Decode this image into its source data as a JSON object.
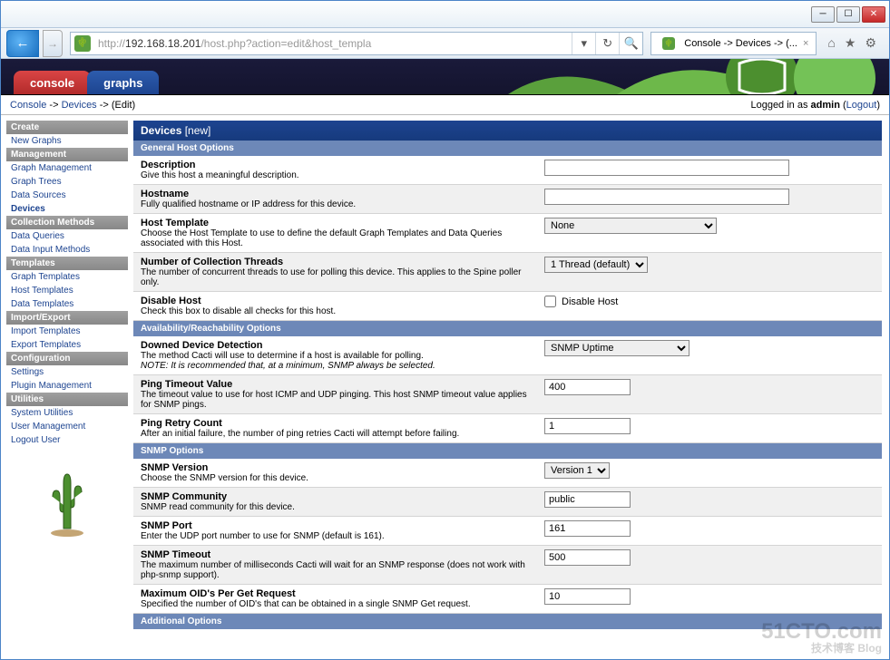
{
  "browser": {
    "url_prefix_grey": "http://",
    "url_host": "192.168.18.201",
    "url_path_grey": "/host.php?action=edit&host_templa",
    "tab_title": "Console -> Devices -> (...",
    "home_icon": "⌂",
    "star_icon": "★",
    "gear_icon": "⚙",
    "back_icon": "←",
    "fwd_icon": "→",
    "refresh_icon": "↻",
    "search_icon": "🔍",
    "dropdown_icon": "▾",
    "close_icon": "×"
  },
  "tabs": {
    "console": "console",
    "graphs": "graphs"
  },
  "breadcrumb": {
    "console": "Console",
    "devices": "Devices",
    "edit": "(Edit)"
  },
  "login": {
    "prefix": "Logged in as ",
    "user": "admin",
    "logout": "Logout"
  },
  "sidebar": {
    "create": "Create",
    "new_graphs": "New Graphs",
    "management": "Management",
    "graph_management": "Graph Management",
    "graph_trees": "Graph Trees",
    "data_sources": "Data Sources",
    "devices": "Devices",
    "collection_methods": "Collection Methods",
    "data_queries": "Data Queries",
    "data_input_methods": "Data Input Methods",
    "templates": "Templates",
    "graph_templates": "Graph Templates",
    "host_templates": "Host Templates",
    "data_templates": "Data Templates",
    "import_export": "Import/Export",
    "import_templates": "Import Templates",
    "export_templates": "Export Templates",
    "configuration": "Configuration",
    "settings": "Settings",
    "plugin_management": "Plugin Management",
    "utilities": "Utilities",
    "system_utilities": "System Utilities",
    "user_management": "User Management",
    "logout_user": "Logout User"
  },
  "panel": {
    "title": "Devices ",
    "new": "[new]"
  },
  "sections": {
    "general": "General Host Options",
    "availability": "Availability/Reachability Options",
    "snmp": "SNMP Options",
    "additional": "Additional Options"
  },
  "fields": {
    "description": {
      "label": "Description",
      "desc": "Give this host a meaningful description.",
      "value": ""
    },
    "hostname": {
      "label": "Hostname",
      "desc": "Fully qualified hostname or IP address for this device.",
      "value": ""
    },
    "host_template": {
      "label": "Host Template",
      "desc": "Choose the Host Template to use to define the default Graph Templates and Data Queries associated with this Host.",
      "value": "None"
    },
    "threads": {
      "label": "Number of Collection Threads",
      "desc": "The number of concurrent threads to use for polling this device. This applies to the Spine poller only.",
      "value": "1 Thread (default)"
    },
    "disable": {
      "label": "Disable Host",
      "desc": "Check this box to disable all checks for this host.",
      "checkbox_label": "Disable Host"
    },
    "downed": {
      "label": "Downed Device Detection",
      "desc": "The method Cacti will use to determine if a host is available for polling.",
      "note": "NOTE: It is recommended that, at a minimum, SNMP always be selected.",
      "value": "SNMP Uptime"
    },
    "ping_timeout": {
      "label": "Ping Timeout Value",
      "desc": "The timeout value to use for host ICMP and UDP pinging. This host SNMP timeout value applies for SNMP pings.",
      "value": "400"
    },
    "ping_retry": {
      "label": "Ping Retry Count",
      "desc": "After an initial failure, the number of ping retries Cacti will attempt before failing.",
      "value": "1"
    },
    "snmp_version": {
      "label": "SNMP Version",
      "desc": "Choose the SNMP version for this device.",
      "value": "Version 1"
    },
    "snmp_community": {
      "label": "SNMP Community",
      "desc": "SNMP read community for this device.",
      "value": "public"
    },
    "snmp_port": {
      "label": "SNMP Port",
      "desc": "Enter the UDP port number to use for SNMP (default is 161).",
      "value": "161"
    },
    "snmp_timeout": {
      "label": "SNMP Timeout",
      "desc": "The maximum number of milliseconds Cacti will wait for an SNMP response (does not work with php-snmp support).",
      "value": "500"
    },
    "max_oid": {
      "label": "Maximum OID's Per Get Request",
      "desc": "Specified the number of OID's that can be obtained in a single SNMP Get request.",
      "value": "10"
    }
  },
  "watermark": {
    "main": "51CTO.com",
    "sub": "技术博客  Blog"
  }
}
